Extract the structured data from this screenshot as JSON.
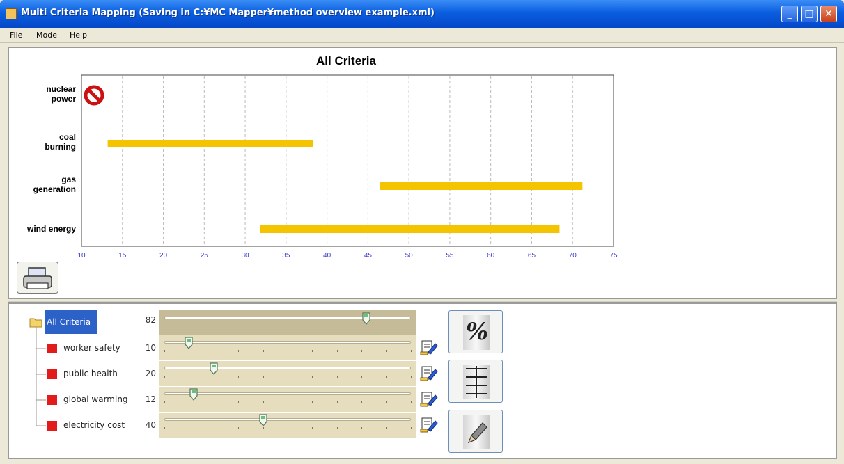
{
  "window": {
    "title": "Multi Criteria Mapping (Saving in C:¥MC Mapper¥method overview example.xml)",
    "controls": [
      "minimize",
      "maximize",
      "close"
    ]
  },
  "menu": [
    "File",
    "Mode",
    "Help"
  ],
  "chart_data": {
    "type": "bar",
    "title": "All Criteria",
    "orientation": "horizontal-range",
    "categories": [
      "nuclear power",
      "coal burning",
      "gas generation",
      "wind energy"
    ],
    "series": [
      {
        "values": [
          null,
          [
            13.2,
            38.3
          ],
          [
            46.5,
            71.2
          ],
          [
            31.8,
            68.4
          ]
        ]
      }
    ],
    "excluded": [
      "nuclear power"
    ],
    "xlim": [
      10,
      75
    ],
    "xticks": [
      10,
      15,
      20,
      25,
      30,
      35,
      40,
      45,
      50,
      55,
      60,
      65,
      70,
      75
    ],
    "grid": true,
    "colors": {
      "bar": "#f5c400",
      "tick_text": "#3a3ad0"
    }
  },
  "criteria_tree": {
    "root": {
      "label": "All Criteria",
      "value": "82",
      "fraction": 0.82
    },
    "children": [
      {
        "label": "worker safety",
        "value": "10",
        "fraction": 0.1
      },
      {
        "label": "public health",
        "value": "20",
        "fraction": 0.2
      },
      {
        "label": "global warming",
        "value": "12",
        "fraction": 0.12
      },
      {
        "label": "electricity cost",
        "value": "40",
        "fraction": 0.4
      }
    ]
  },
  "side_buttons": [
    {
      "icon": "percent-icon",
      "glyph": "%"
    },
    {
      "icon": "columns-icon"
    },
    {
      "icon": "pencil-icon"
    }
  ],
  "colors": {
    "criterion_square": "#e21b1b",
    "selection": "#2c62c8"
  }
}
